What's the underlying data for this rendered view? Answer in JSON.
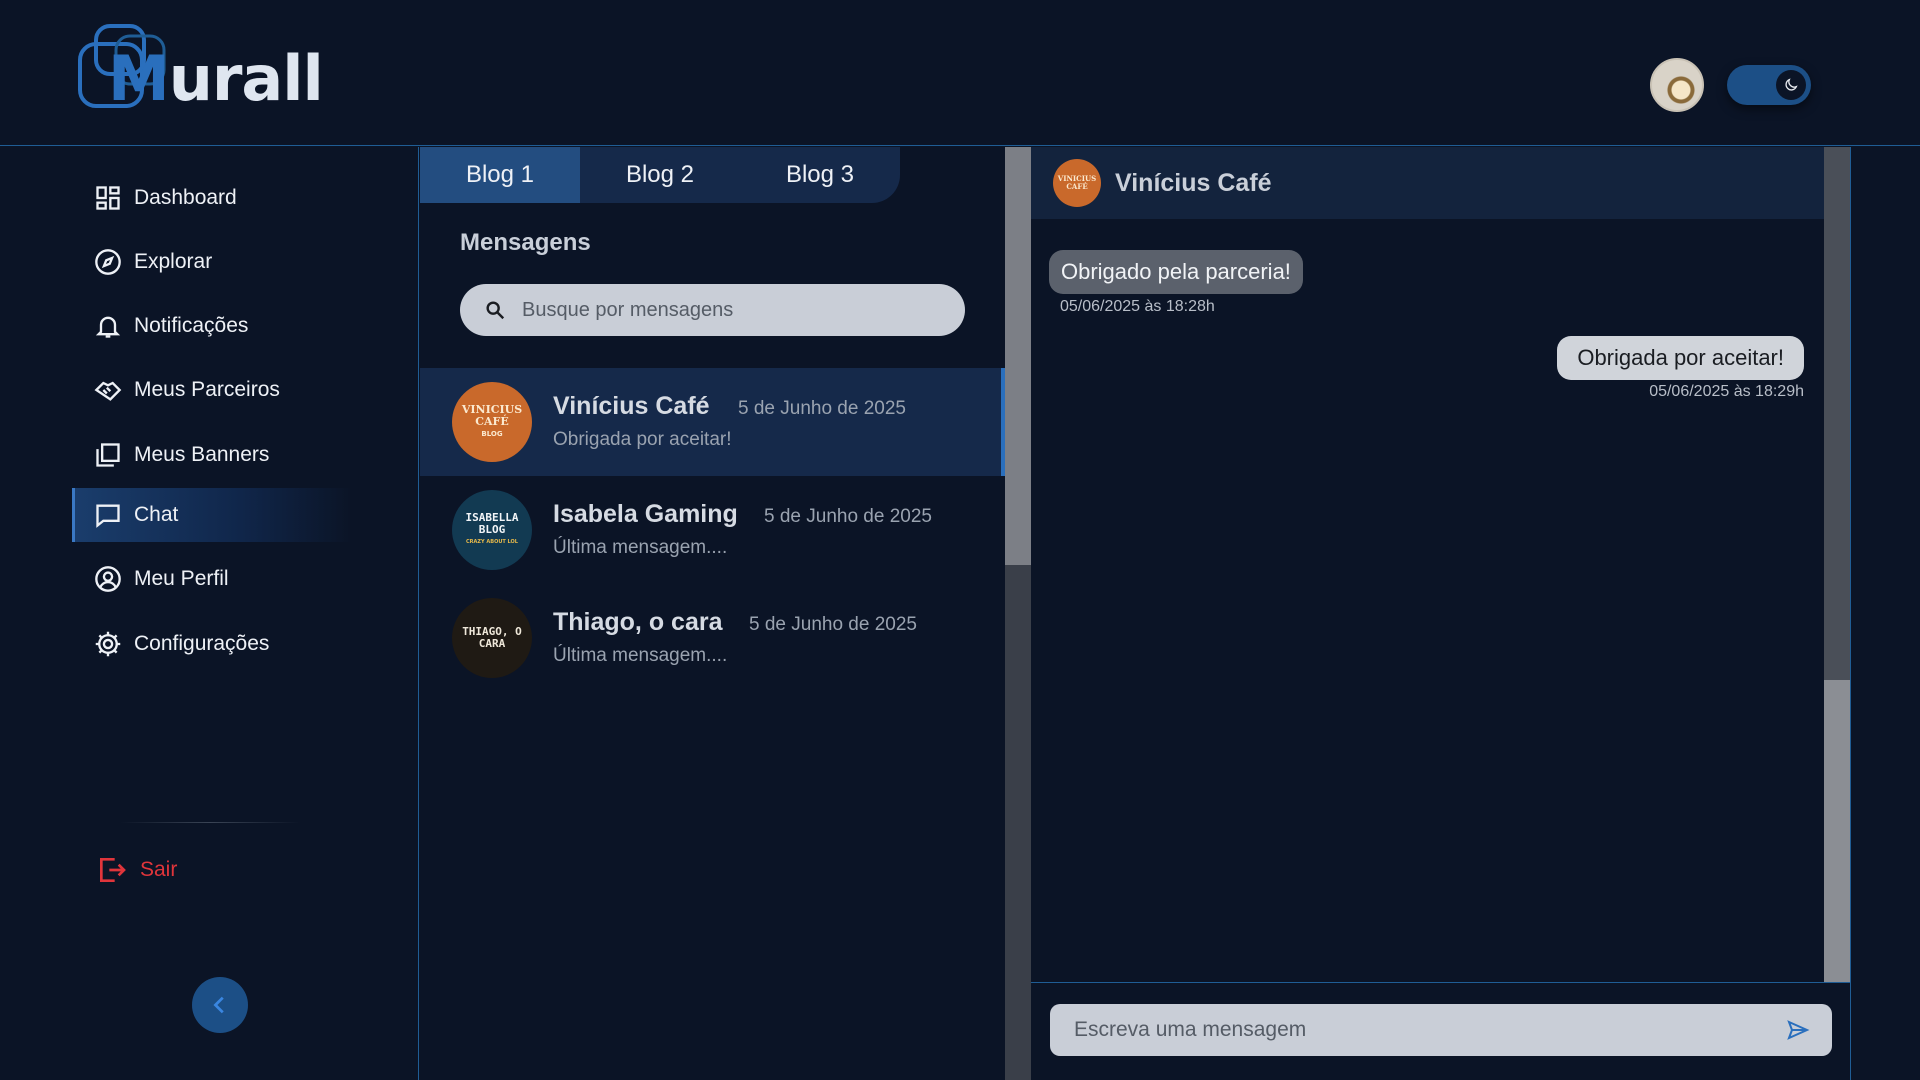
{
  "header": {
    "logo_m": "M",
    "logo_rest": "urall",
    "avatar_icon": "user-avatar-icon",
    "theme_toggle_icon": "moon-icon"
  },
  "sidebar": {
    "items": [
      {
        "label": "Dashboard",
        "icon": "dashboard-icon"
      },
      {
        "label": "Explorar",
        "icon": "compass-icon"
      },
      {
        "label": "Notificações",
        "icon": "bell-icon"
      },
      {
        "label": "Meus Parceiros",
        "icon": "handshake-icon"
      },
      {
        "label": "Meus Banners",
        "icon": "gallery-icon"
      },
      {
        "label": "Chat",
        "icon": "chat-icon",
        "active": true
      },
      {
        "label": "Meu Perfil",
        "icon": "profile-icon"
      },
      {
        "label": "Configurações",
        "icon": "gear-icon"
      }
    ],
    "logout_label": "Sair",
    "logout_color": "#e0353b"
  },
  "messages": {
    "tabs": [
      "Blog 1",
      "Blog 2",
      "Blog 3"
    ],
    "active_tab": "Blog 1",
    "title": "Mensagens",
    "search_placeholder": "Busque por mensagens",
    "conversations": [
      {
        "name": "Vinícius Café",
        "date": "5 de Junho de 2025",
        "preview": "Obrigada por aceitar!",
        "avatar_text": "VINICIUS CAFÉ",
        "avatar_sub": "BLOG",
        "avatar_color": "#c9692b",
        "active": true
      },
      {
        "name": "Isabela Gaming",
        "date": "5 de Junho de 2025",
        "preview": "Última mensagem....",
        "avatar_text": "ISABELLA BLOG",
        "avatar_sub": "CRAZY ABOUT LOL",
        "avatar_color": "#123a52"
      },
      {
        "name": "Thiago, o cara",
        "date": "5 de Junho de 2025",
        "preview": "Última mensagem....",
        "avatar_text": "THIAGO, O CARA",
        "avatar_sub": "",
        "avatar_color": "#1f1a14"
      }
    ]
  },
  "chat": {
    "contact_name": "Vinícius Café",
    "contact_avatar_text": "VINICIUS CAFÉ",
    "messages": [
      {
        "direction": "in",
        "text": "Obrigado pela parceria!",
        "time": "05/06/2025 às 18:28h"
      },
      {
        "direction": "out",
        "text": "Obrigada por aceitar!",
        "time": "05/06/2025 às 18:29h"
      }
    ],
    "composer_placeholder": "Escreva uma mensagem",
    "send_icon": "send-icon"
  },
  "colors": {
    "background": "#0b1426",
    "accent": "#2a6fbd",
    "active_nav": "#1a3d6c"
  }
}
